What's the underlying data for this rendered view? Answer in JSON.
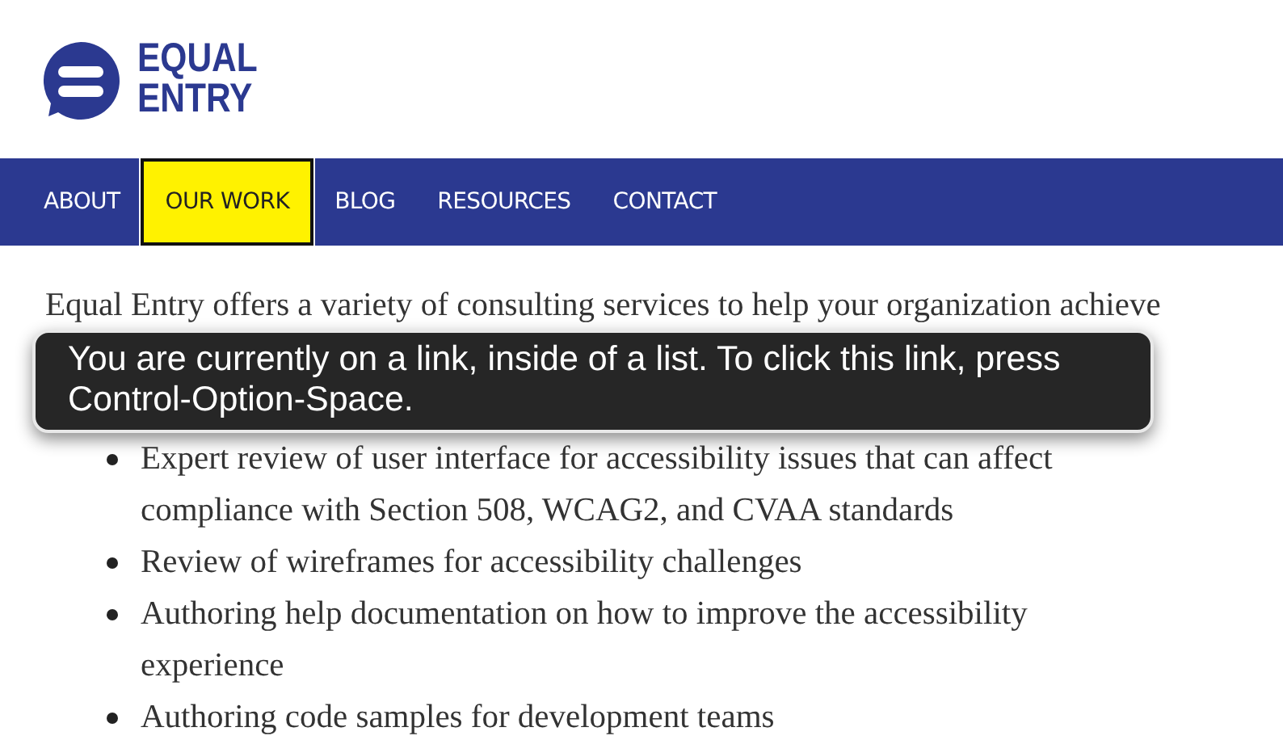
{
  "logo": {
    "lines": [
      "EQUAL",
      "ENTRY"
    ]
  },
  "nav": [
    {
      "label": "ABOUT",
      "selected": false
    },
    {
      "label": "OUR WORK",
      "selected": true
    },
    {
      "label": "BLOG",
      "selected": false
    },
    {
      "label": "RESOURCES",
      "selected": false
    },
    {
      "label": "CONTACT",
      "selected": false
    }
  ],
  "intro": "Equal Entry offers a variety of consulting services to help your organization achieve",
  "tooltip": "You are currently on a link, inside of a list. To click this link, press Control-Option-Space.",
  "services": [
    "Expert review of user interface for accessibility issues that can affect compliance with Section 508, WCAG2, and CVAA standards",
    "Review of wireframes for accessibility challenges",
    "Authoring help documentation on how to improve the accessibility experience",
    "Authoring code samples for development teams"
  ]
}
